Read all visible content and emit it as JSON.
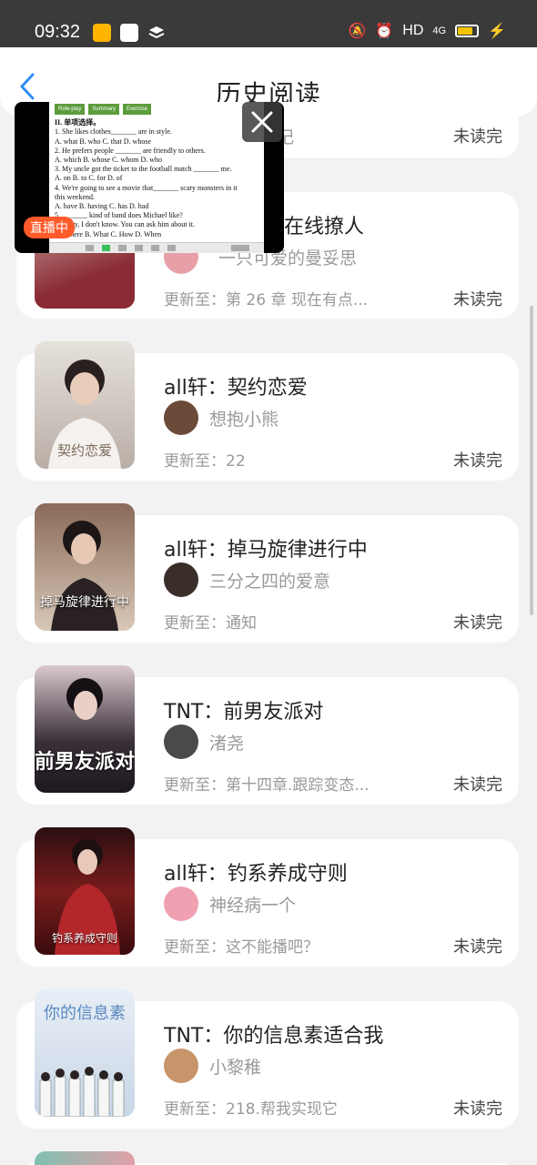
{
  "status_bar": {
    "time": "09:32",
    "network": "HD",
    "signal": "4G",
    "battery_color": "#f5c400"
  },
  "header": {
    "title": "历史阅读"
  },
  "floating_window": {
    "badge": "直播中",
    "tabs": [
      "Role-play",
      "Summary",
      "Exercise"
    ],
    "lines": [
      "II. 单项选择。",
      "1. She likes clothes_______ are in style.",
      "A. what   B. who  C. that     D. whose",
      "2. He prefers people _______ are friendly to others.",
      "A. which   B. whose     C. whom  D. who",
      "3. My uncle got the ticket to the football  match _______ me.",
      "A. on    B. to        C. for         D. of",
      "4. We're going to see a movie that_______ scary monsters in it",
      "this weekend.",
      "   A. have      B. having       C. has        D. had",
      "5. _______ kind of band does Michael like?",
      "   —Sorry, I don't know. You can ask him about it.",
      "     A. Where     B. What      C. How        D. When"
    ]
  },
  "books": [
    {
      "title": "",
      "author": "",
      "update": "记",
      "status": "未读完",
      "avatar_color": "#cccccc",
      "cover_color": "#c9c9c9",
      "cover_text": ""
    },
    {
      "title": "宗在线撩人",
      "author": "一只可爱的曼妥思",
      "update": "更新至：第 26 章 现在有点...",
      "status": "未读完",
      "avatar_color": "#e8a0a8",
      "cover_color": "#8a2b35",
      "cover_text": ""
    },
    {
      "title": "all轩：契约恋爱",
      "author": "想抱小熊",
      "update": "更新至：22",
      "status": "未读完",
      "avatar_color": "#6b4a3a",
      "cover_color": "#d8cfc6",
      "cover_text": "契约恋爱"
    },
    {
      "title": "all轩：掉马旋律进行中",
      "author": "三分之四的爱意",
      "update": "更新至：通知",
      "status": "未读完",
      "avatar_color": "#3a2e2a",
      "cover_color": "#b69a88",
      "cover_text": "掉马旋律进行中"
    },
    {
      "title": "TNT：前男友派对",
      "author": "渚尧",
      "update": "更新至：第十四章.跟踪变态...",
      "status": "未读完",
      "avatar_color": "#4a4a4a",
      "cover_color": "#2b2430",
      "cover_text": "前男友派对"
    },
    {
      "title": "all轩：钓系养成守则",
      "author": "神经病一个",
      "update": "更新至：这不能播吧？",
      "status": "未读完",
      "avatar_color": "#f0a0b0",
      "cover_color": "#7a1c1c",
      "cover_text": "钓系养成守则"
    },
    {
      "title": "TNT：你的信息素适合我",
      "author": "小黎稚",
      "update": "更新至：218.帮我实现它",
      "status": "未读完",
      "avatar_color": "#c8946a",
      "cover_color": "#dfe6f0",
      "cover_text": "你的信息素"
    }
  ]
}
